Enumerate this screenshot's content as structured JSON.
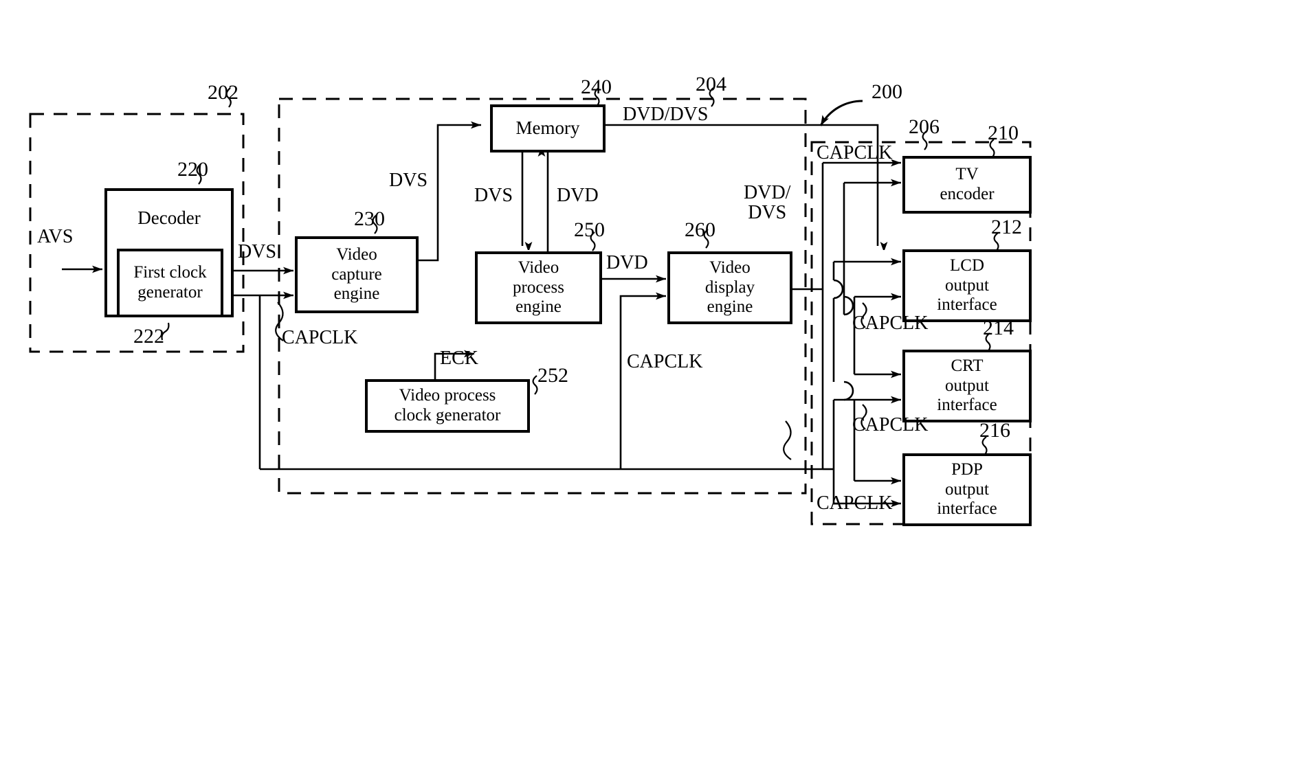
{
  "figure": {
    "type": "patent-block-diagram",
    "title": "Video processing system block diagram"
  },
  "blocks": [
    {
      "id": "decoder",
      "label": "Decoder",
      "ref": "220"
    },
    {
      "id": "first_clock",
      "label": "First clock\ngenerator",
      "ref": "222"
    },
    {
      "id": "video_capture",
      "label": "Video\ncapture\nengine",
      "ref": "230"
    },
    {
      "id": "memory",
      "label": "Memory",
      "ref": "240"
    },
    {
      "id": "video_process",
      "label": "Video\nprocess\nengine",
      "ref": "250"
    },
    {
      "id": "vp_clock",
      "label": "Video process\nclock generator",
      "ref": "252"
    },
    {
      "id": "video_display",
      "label": "Video\ndisplay\nengine",
      "ref": "260"
    },
    {
      "id": "tv_encoder",
      "label": "TV\nencoder",
      "ref": "210"
    },
    {
      "id": "lcd_out",
      "label": "LCD\noutput\ninterface",
      "ref": "212"
    },
    {
      "id": "crt_out",
      "label": "CRT\noutput\ninterface",
      "ref": "214"
    },
    {
      "id": "pdp_out",
      "label": "PDP\noutput\ninterface",
      "ref": "216"
    }
  ],
  "block_text": {
    "decoder": "Decoder",
    "first_clock_l1": "First clock",
    "first_clock_l2": "generator",
    "video_capture_l1": "Video",
    "video_capture_l2": "capture",
    "video_capture_l3": "engine",
    "memory": "Memory",
    "video_process_l1": "Video",
    "video_process_l2": "process",
    "video_process_l3": "engine",
    "vp_clock_l1": "Video process",
    "vp_clock_l2": "clock generator",
    "video_display_l1": "Video",
    "video_display_l2": "display",
    "video_display_l3": "engine",
    "tv_encoder_l1": "TV",
    "tv_encoder_l2": "encoder",
    "lcd_l1": "LCD",
    "lcd_l2": "output",
    "lcd_l3": "interface",
    "crt_l1": "CRT",
    "crt_l2": "output",
    "crt_l3": "interface",
    "pdp_l1": "PDP",
    "pdp_l2": "output",
    "pdp_l3": "interface"
  },
  "reference_numerals": {
    "system": "200",
    "decoder_group": "202",
    "core_group": "204",
    "output_group": "206",
    "decoder": "220",
    "first_clock": "222",
    "video_capture": "230",
    "memory": "240",
    "video_process": "250",
    "vp_clock": "252",
    "video_display": "260",
    "tv_encoder": "210",
    "lcd_out": "212",
    "crt_out": "214",
    "pdp_out": "216"
  },
  "signal_labels": {
    "avs": "AVS",
    "dvs_decoder_out": "DVS",
    "dvs_capture_to_mem": "DVS",
    "dvs_mem_to_process": "DVS",
    "dvd_process_to_mem": "DVD",
    "dvd_dvs_mem_out": "DVD/DVS",
    "dvd_process_out": "DVD",
    "dvd_dvs_display_in": "DVD/\nDVS",
    "capclk_capture": "CAPCLK",
    "eck": "ECK",
    "capclk_display": "CAPCLK",
    "capclk_tv": "CAPCLK",
    "capclk_lcd": "CAPCLK",
    "capclk_crt": "CAPCLK",
    "capclk_pdp": "CAPCLK"
  },
  "colors": {
    "stroke": "#000000",
    "background": "#ffffff"
  }
}
